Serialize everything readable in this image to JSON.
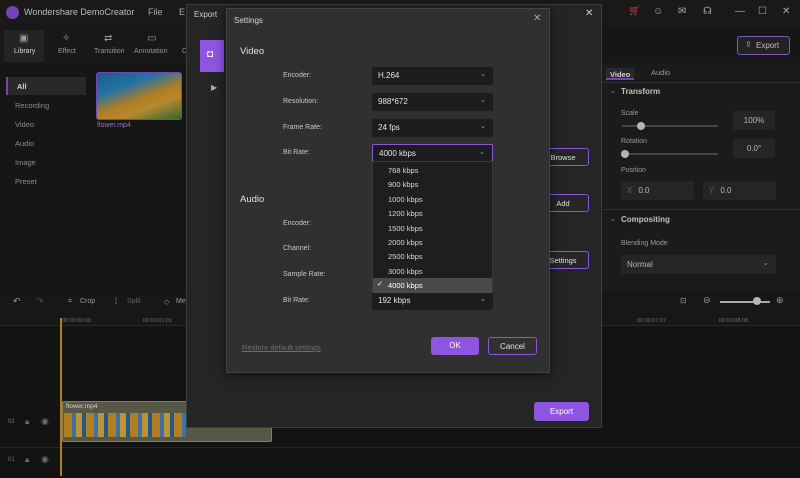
{
  "app": {
    "title": "Wondershare DemoCreator",
    "menu": [
      "File",
      "E"
    ]
  },
  "toolbar": {
    "tabs": [
      "Library",
      "Effect",
      "Transition",
      "Annotation",
      "C"
    ],
    "export_label": "Export"
  },
  "library": {
    "items": [
      "All",
      "Recording",
      "Video",
      "Audio",
      "Image",
      "Preset"
    ],
    "clip_caption": "flower.mp4"
  },
  "right_panel": {
    "tabs": [
      "Video",
      "Audio"
    ],
    "transform": "Transform",
    "scale_label": "Scale",
    "scale_value": "100%",
    "rotation_label": "Rotation",
    "rotation_value": "0.0°",
    "position_label": "Position",
    "pos_x_label": "X",
    "pos_x": "0.0",
    "pos_y_label": "Y",
    "pos_y": "0.0",
    "compositing": "Compositing",
    "blend_label": "Blending Mode",
    "blend_value": "Normal"
  },
  "timeline": {
    "tools": [
      "Crop",
      "Split",
      "Me"
    ],
    "ticks": [
      "00:00:00:00",
      "00:00:01:01",
      "00:00:07:07",
      "00:00:08:08"
    ],
    "clip_label": "flower.mp4",
    "track_nums": [
      "02",
      "01"
    ]
  },
  "export_dialog": {
    "title": "Export",
    "browse": "Browse",
    "add": "Add",
    "settings": "Settings",
    "export": "Export"
  },
  "settings": {
    "title": "Settings",
    "video_head": "Video",
    "audio_head": "Audio",
    "video": {
      "encoder_label": "Encoder:",
      "encoder": "H.264",
      "resolution_label": "Resolution:",
      "resolution": "988*672",
      "framerate_label": "Frame Rate:",
      "framerate": "24 fps",
      "bitrate_label": "Bit Rate:",
      "bitrate": "4000 kbps"
    },
    "audio": {
      "encoder_label": "Encoder:",
      "channel_label": "Channel:",
      "samplerate_label": "Sample Rate:",
      "bitrate_label": "Bit Rate:",
      "bitrate": "192 kbps"
    },
    "bitrate_options": [
      "768 kbps",
      "900 kbps",
      "1000 kbps",
      "1200 kbps",
      "1500 kbps",
      "2000 kbps",
      "2500 kbps",
      "3000 kbps",
      "4000 kbps"
    ],
    "selected_option": "4000 kbps",
    "restore": "Restore default settings",
    "ok": "OK",
    "cancel": "Cancel"
  },
  "colors": {
    "accent": "#8e55e0",
    "playhead": "#d49a2a"
  }
}
